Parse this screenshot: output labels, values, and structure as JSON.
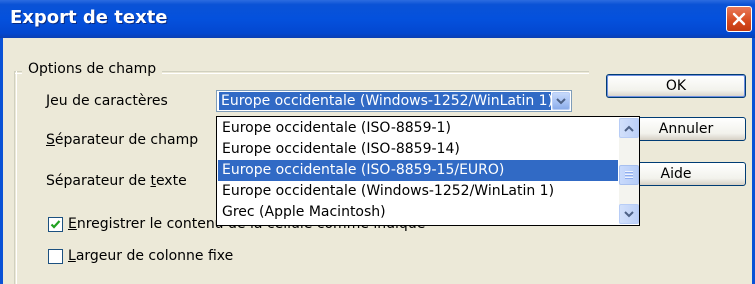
{
  "window": {
    "title": "Export de texte"
  },
  "field_options": {
    "group_label": "Options de champ",
    "charset_label": "Jeu de caractères",
    "charset_value": "Europe occidentale (Windows-1252/WinLatin 1)",
    "field_sep_label": "Séparateur de champ",
    "text_sep_label": "Séparateur de texte",
    "save_as_shown_label": "Enregistrer le contenu de la cellule comme indiqué",
    "save_as_shown_checked": true,
    "fixed_width_label": "Largeur de colonne fixe",
    "fixed_width_checked": false
  },
  "dropdown": {
    "options": [
      "Europe occidentale (ISO-8859-1)",
      "Europe occidentale (ISO-8859-14)",
      "Europe occidentale (ISO-8859-15/EURO)",
      "Europe occidentale (Windows-1252/WinLatin 1)",
      "Grec (Apple Macintosh)"
    ],
    "highlighted": "Europe occidentale (ISO-8859-15/EURO)"
  },
  "buttons": {
    "ok": "OK",
    "cancel": "Annuler",
    "help": "Aide"
  },
  "colors": {
    "titlebar": "#0451dd",
    "highlight": "#316ac5",
    "dialog_bg": "#ece9d8"
  }
}
